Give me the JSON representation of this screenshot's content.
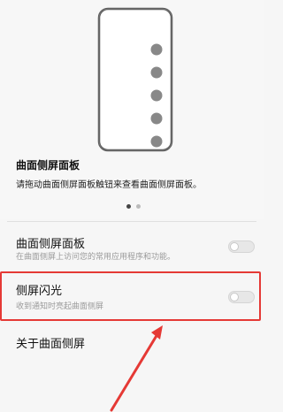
{
  "preview": {
    "title": "曲面侧屏面板",
    "description": "请拖动曲面侧屏面板触钮来查看曲面侧屏面板。",
    "page_count": 2,
    "active_page": 1
  },
  "settings": [
    {
      "title": "曲面侧屏面板",
      "subtitle": "在曲面侧屏上访问您的常用应用程序和功能。",
      "toggle_state": "off"
    },
    {
      "title": "侧屏闪光",
      "subtitle": "收到通知时亮起曲面侧屏",
      "toggle_state": "off",
      "highlighted": true
    },
    {
      "title": "关于曲面侧屏"
    }
  ],
  "colors": {
    "highlight": "#e53935",
    "background": "#f6f6f6",
    "toggle_off": "#e7e7e7"
  }
}
